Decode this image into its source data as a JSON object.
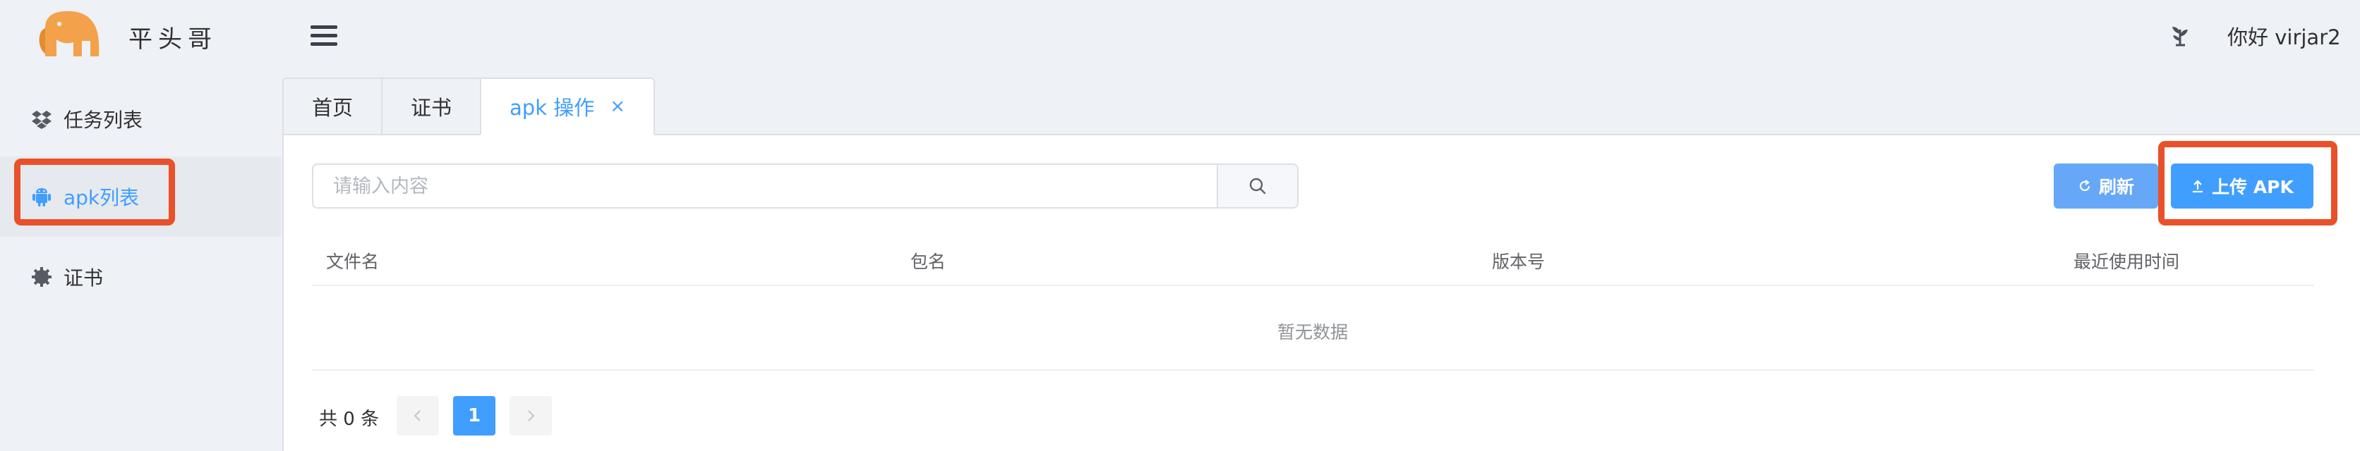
{
  "header": {
    "brand": "平头哥",
    "user_name": "你好 virjar2",
    "icons": [
      "logo-elephant",
      "menu-icon",
      "user-leaf-icon"
    ]
  },
  "sidebar": {
    "items": [
      {
        "label": "任务列表",
        "icon": "dropbox-icon",
        "active": false
      },
      {
        "label": "apk列表",
        "icon": "android-icon",
        "active": true
      },
      {
        "label": "证书",
        "icon": "gear-icon",
        "active": false
      }
    ]
  },
  "tabs": [
    {
      "label": "首页",
      "active": false
    },
    {
      "label": "证书",
      "active": false
    },
    {
      "label": "apk 操作",
      "active": true,
      "close": "×"
    }
  ],
  "toolbar": {
    "search_placeholder": "请输入内容",
    "refresh_label": "刷新",
    "upload_label": "上传 APK"
  },
  "table": {
    "columns": [
      "文件名",
      "包名",
      "版本号",
      "最近使用时间"
    ],
    "empty_text": "暂无数据"
  },
  "pagination": {
    "total_text": "共 0 条",
    "current_page": "1"
  },
  "colors": {
    "accent": "#409eff",
    "highlight": "#e8512a",
    "background": "#eef1f6"
  }
}
